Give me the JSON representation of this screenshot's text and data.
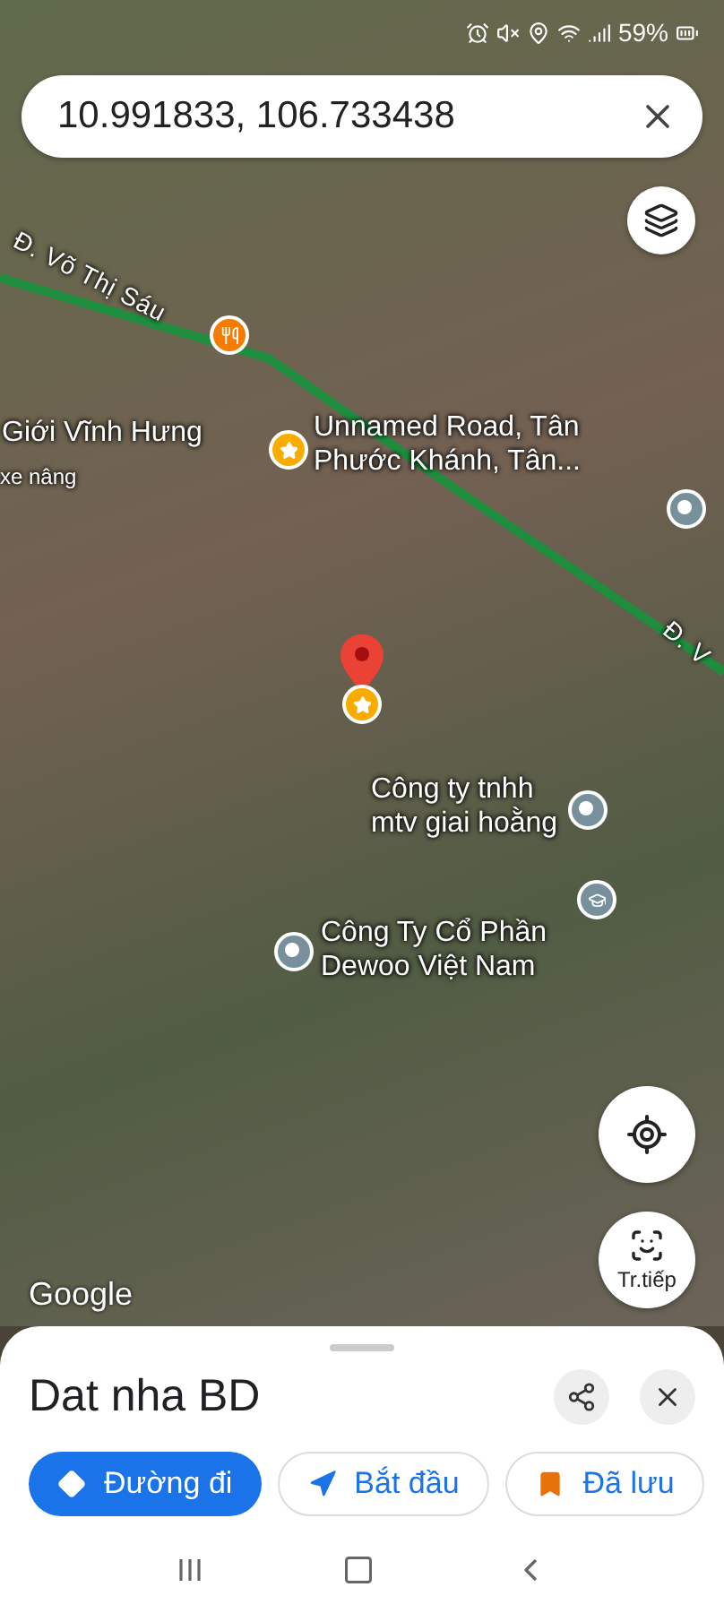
{
  "status_bar": {
    "battery": "59%"
  },
  "search": {
    "value": "10.991833, 106.733438"
  },
  "map": {
    "labels": [
      {
        "kind": "road",
        "text": "Đ. Võ Thị Sáu"
      },
      {
        "kind": "place",
        "text": "Giới Vĩnh Hưng"
      },
      {
        "kind": "minor",
        "text": "xe nâng"
      },
      {
        "kind": "place",
        "text": "Unnamed Road, Tân Phước Khánh, Tân..."
      },
      {
        "kind": "place",
        "text": "Công ty tnhh mtv giai hoằng"
      },
      {
        "kind": "place",
        "text": "Công Ty Cổ Phần Dewoo Việt Nam"
      },
      {
        "kind": "road",
        "text": "Đ. V"
      }
    ],
    "pins": [
      {
        "kind": "food"
      },
      {
        "kind": "star"
      },
      {
        "kind": "place"
      },
      {
        "kind": "dropped"
      },
      {
        "kind": "place"
      },
      {
        "kind": "school"
      },
      {
        "kind": "place"
      }
    ],
    "attribution": "Google",
    "live_view": "Tr.tiếp"
  },
  "sheet": {
    "title": "Dat nha BD",
    "actions": [
      {
        "kind": "directions",
        "label": "Đường đi"
      },
      {
        "kind": "start",
        "label": "Bắt đầu"
      },
      {
        "kind": "saved",
        "label": "Đã lưu"
      }
    ]
  }
}
